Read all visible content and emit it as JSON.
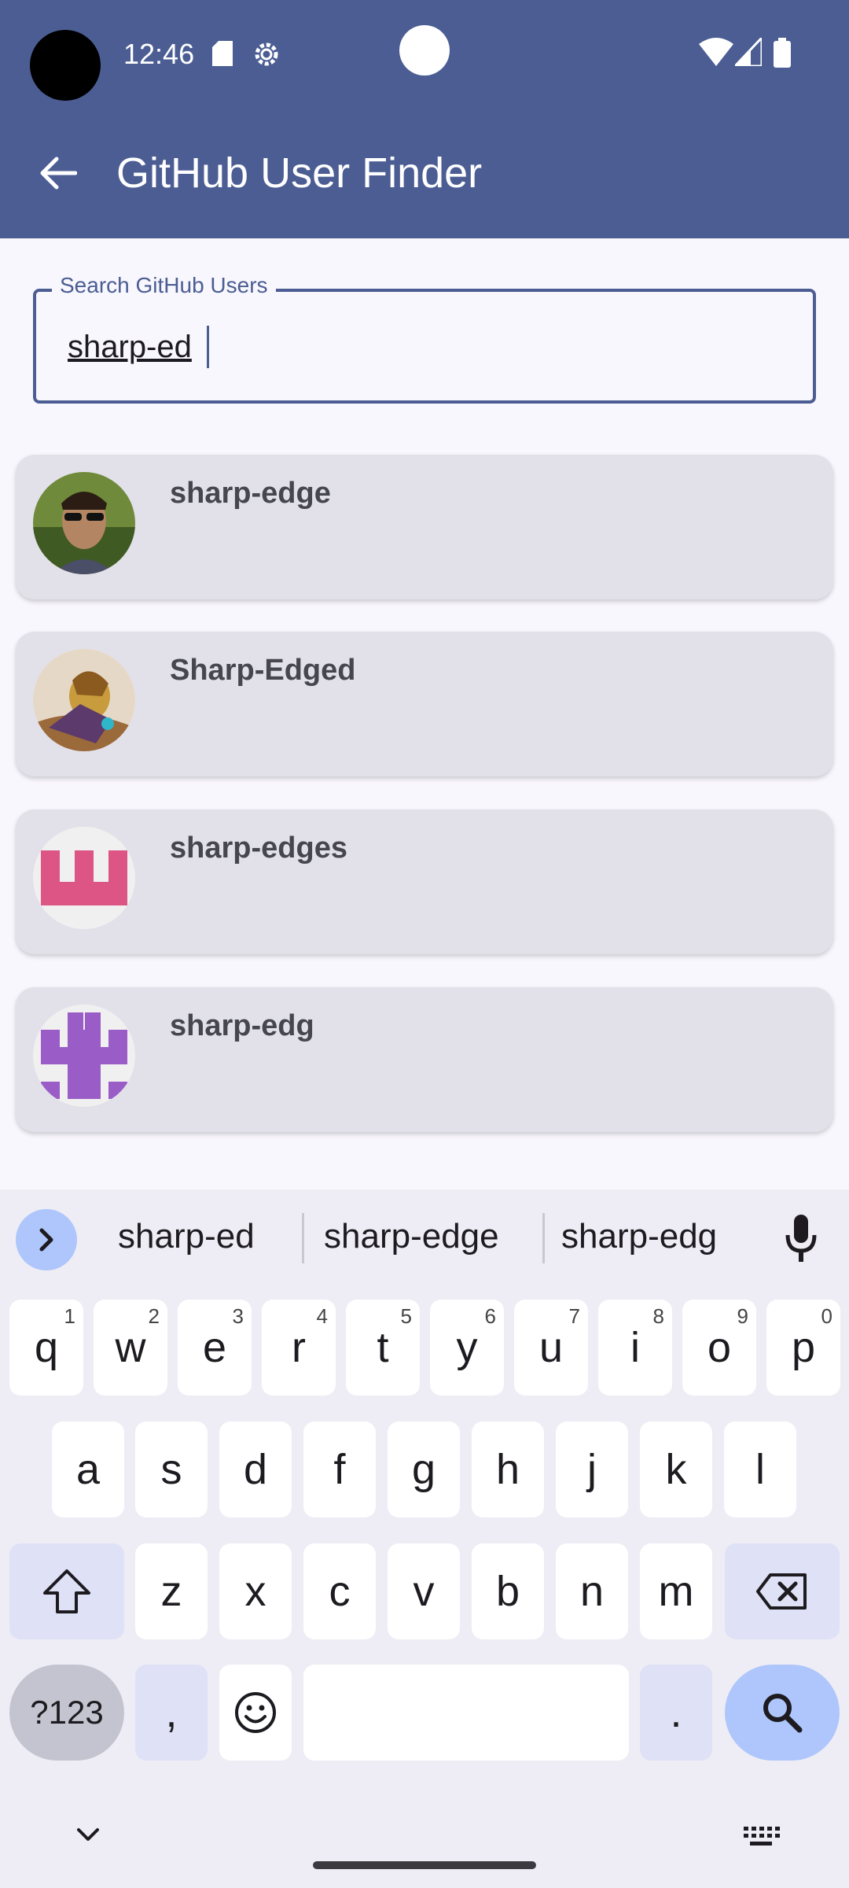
{
  "status_bar": {
    "time": "12:46"
  },
  "app_bar": {
    "title": "GitHub User Finder"
  },
  "search": {
    "label": "Search GitHub Users",
    "value": "sharp-ed"
  },
  "results": [
    {
      "name": "sharp-edge",
      "avatar": "photo-sunglasses"
    },
    {
      "name": "Sharp-Edged",
      "avatar": "photo-armored-character"
    },
    {
      "name": "sharp-edges",
      "avatar": "identicon-pink"
    },
    {
      "name": "sharp-edg",
      "avatar": "identicon-purple"
    }
  ],
  "keyboard": {
    "suggestions": [
      "sharp-ed",
      "sharp-edge",
      "sharp-edg"
    ],
    "row1": [
      {
        "k": "q",
        "h": "1"
      },
      {
        "k": "w",
        "h": "2"
      },
      {
        "k": "e",
        "h": "3"
      },
      {
        "k": "r",
        "h": "4"
      },
      {
        "k": "t",
        "h": "5"
      },
      {
        "k": "y",
        "h": "6"
      },
      {
        "k": "u",
        "h": "7"
      },
      {
        "k": "i",
        "h": "8"
      },
      {
        "k": "o",
        "h": "9"
      },
      {
        "k": "p",
        "h": "0"
      }
    ],
    "row2": [
      "a",
      "s",
      "d",
      "f",
      "g",
      "h",
      "j",
      "k",
      "l"
    ],
    "row3": [
      "z",
      "x",
      "c",
      "v",
      "b",
      "n",
      "m"
    ],
    "symbols_label": "?123",
    "comma": ",",
    "period": "."
  },
  "colors": {
    "primary": "#4b5d93",
    "card": "#e2e1ea",
    "accent_key": "#aec6fb"
  }
}
